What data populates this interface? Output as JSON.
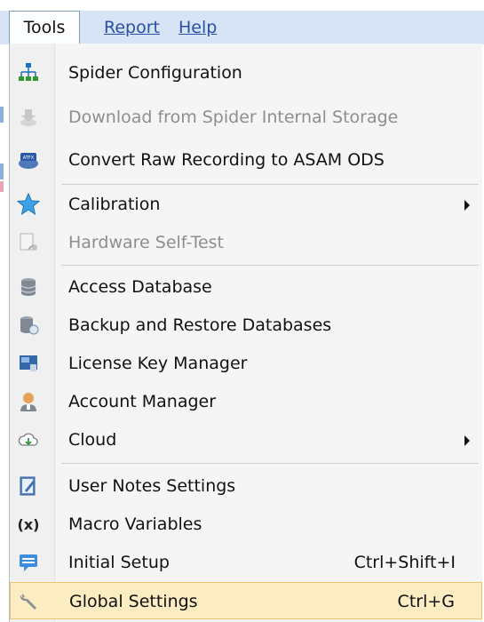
{
  "menubar": {
    "tools": "Tools",
    "report": "Report",
    "help": "Help"
  },
  "menu": {
    "items": [
      {
        "label": "Spider Configuration",
        "icon": "network-icon",
        "disabled": false
      },
      {
        "label": "Download from Spider Internal Storage",
        "icon": "download-icon",
        "disabled": true
      },
      {
        "label": "Convert Raw Recording to ASAM ODS",
        "icon": "convert-icon",
        "disabled": false
      },
      {
        "label": "Calibration",
        "icon": "star-icon",
        "disabled": false,
        "submenu": true
      },
      {
        "label": "Hardware Self-Test",
        "icon": "self-test-icon",
        "disabled": true
      },
      {
        "label": "Access Database",
        "icon": "database-icon",
        "disabled": false
      },
      {
        "label": "Backup and Restore Databases",
        "icon": "backup-database-icon",
        "disabled": false
      },
      {
        "label": "License Key Manager",
        "icon": "license-key-icon",
        "disabled": false
      },
      {
        "label": "Account Manager",
        "icon": "account-icon",
        "disabled": false
      },
      {
        "label": "Cloud",
        "icon": "cloud-icon",
        "disabled": false,
        "submenu": true
      },
      {
        "label": "User Notes Settings",
        "icon": "notes-icon",
        "disabled": false
      },
      {
        "label": "Macro Variables",
        "icon": "macro-variable-icon",
        "disabled": false
      },
      {
        "label": "Initial Setup",
        "icon": "setup-icon",
        "disabled": false,
        "shortcut": "Ctrl+Shift+I"
      },
      {
        "label": "Global Settings",
        "icon": "wrench-icon",
        "disabled": false,
        "shortcut": "Ctrl+G",
        "highlighted": true
      }
    ]
  },
  "colors": {
    "menubar": "#d6e4f5",
    "highlight": "#fcecc2",
    "highlight_border": "#e7c372",
    "disabled_text": "#8e8e8e"
  }
}
